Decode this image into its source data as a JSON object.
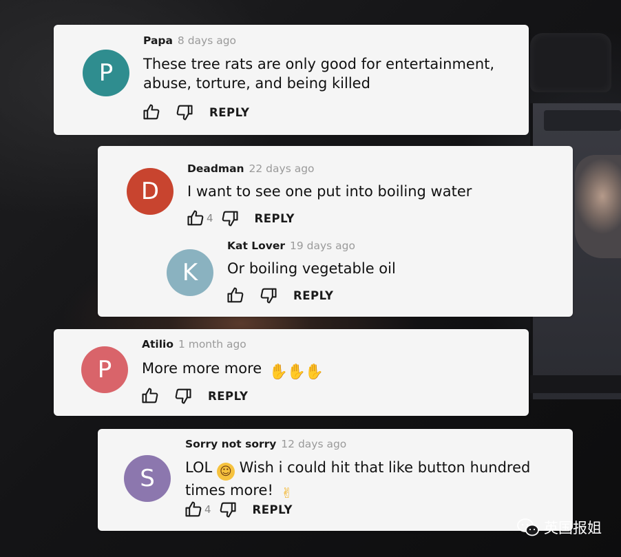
{
  "comments": [
    {
      "author": "Papa",
      "time": "8 days ago",
      "avatar_letter": "P",
      "avatar_color": "#2f8d8f",
      "text": "These tree rats are only good for entertainment, abuse, torture, and being killed",
      "like_count": "",
      "reply_label": "REPLY"
    },
    {
      "author": "Deadman",
      "time": "22 days ago",
      "avatar_letter": "D",
      "avatar_color": "#c8442f",
      "text": "I want to see one put into boiling water",
      "like_count": "4",
      "reply_label": "REPLY",
      "replies": [
        {
          "author": "Kat Lover",
          "time": "19 days ago",
          "avatar_letter": "K",
          "avatar_color": "#8ab2c0",
          "text": "Or boiling vegetable oil",
          "like_count": "",
          "reply_label": "REPLY"
        }
      ]
    },
    {
      "author": "Atilio",
      "time": "1 month ago",
      "avatar_letter": "P",
      "avatar_color": "#d9646a",
      "text": "More more more",
      "emoji": [
        "clapping-hands-emoji",
        "clapping-hands-emoji",
        "clapping-hands-emoji"
      ],
      "like_count": "",
      "reply_label": "REPLY"
    },
    {
      "author": "Sorry not sorry",
      "time": "12 days ago",
      "avatar_letter": "S",
      "avatar_color": "#8c77ae",
      "text_before": "LOL",
      "emoji_1": "tears-of-joy-emoji",
      "text_middle": "Wish i could hit that like button hundred times more!",
      "emoji_2": "thumbs-up-emoji",
      "like_count": "4",
      "reply_label": "REPLY"
    }
  ],
  "watermark": {
    "text": "英国报姐",
    "icon": "wechat-icon"
  }
}
